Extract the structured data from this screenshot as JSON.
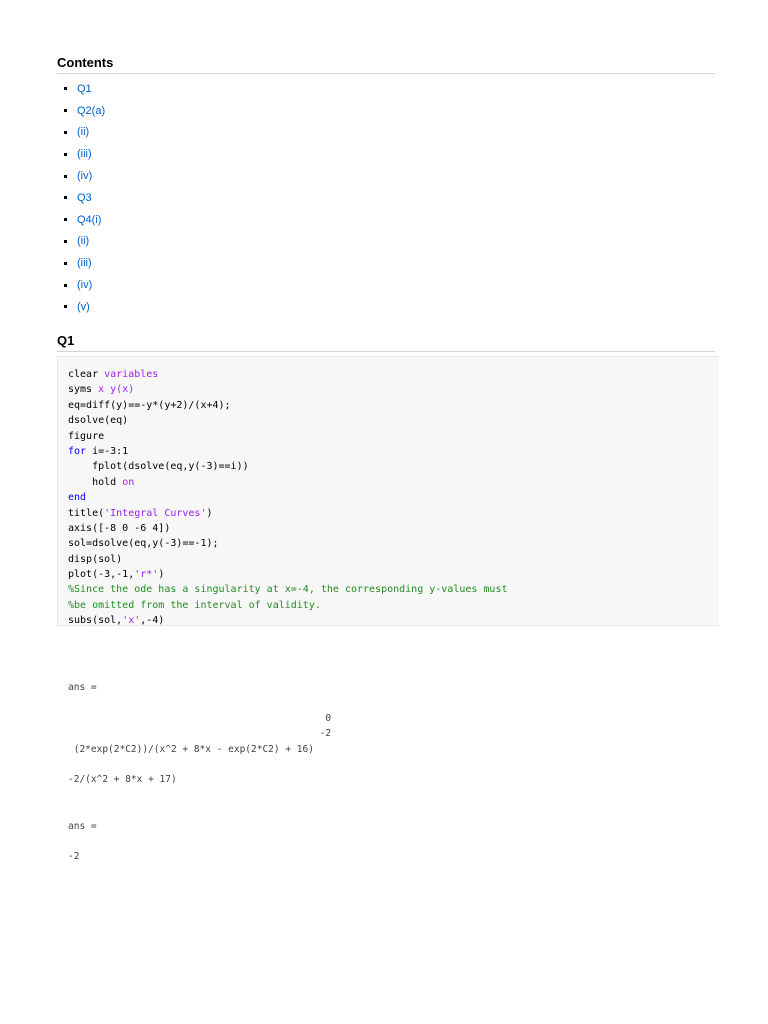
{
  "contents": {
    "heading": "Contents",
    "items": [
      "Q1",
      "Q2(a)",
      "(ii)",
      "(iii)",
      "(iv)",
      "Q3",
      "Q4(i)",
      "(ii)",
      "(iii)",
      "(iv)",
      "(v)"
    ]
  },
  "q1": {
    "heading": "Q1",
    "code": [
      [
        {
          "t": "clear ",
          "c": ""
        },
        {
          "t": "variables",
          "c": "str"
        }
      ],
      [
        {
          "t": "syms ",
          "c": ""
        },
        {
          "t": "x y(x)",
          "c": "str"
        }
      ],
      [
        {
          "t": "eq=diff(y)==-y*(y+2)/(x+4);",
          "c": ""
        }
      ],
      [
        {
          "t": "dsolve(eq)",
          "c": ""
        }
      ],
      [
        {
          "t": "figure",
          "c": ""
        }
      ],
      [
        {
          "t": "for",
          "c": "kw"
        },
        {
          "t": " i=-3:1",
          "c": ""
        }
      ],
      [
        {
          "t": "    fplot(dsolve(eq,y(-3)==i))",
          "c": ""
        }
      ],
      [
        {
          "t": "    hold ",
          "c": ""
        },
        {
          "t": "on",
          "c": "str"
        }
      ],
      [
        {
          "t": "end",
          "c": "kw"
        }
      ],
      [
        {
          "t": "title(",
          "c": ""
        },
        {
          "t": "'Integral Curves'",
          "c": "str"
        },
        {
          "t": ")",
          "c": ""
        }
      ],
      [
        {
          "t": "axis([-8 0 -6 4])",
          "c": ""
        }
      ],
      [
        {
          "t": "sol=dsolve(eq,y(-3)==-1);",
          "c": ""
        }
      ],
      [
        {
          "t": "disp(sol)",
          "c": ""
        }
      ],
      [
        {
          "t": "plot(-3,-1,",
          "c": ""
        },
        {
          "t": "'r*'",
          "c": "str"
        },
        {
          "t": ")",
          "c": ""
        }
      ],
      [
        {
          "t": "%Since the ode has a singularity at x=-4, the corresponding y-values must",
          "c": "cmt"
        }
      ],
      [
        {
          "t": "%be omitted from the interval of validity.",
          "c": "cmt"
        }
      ],
      [
        {
          "t": "subs(sol,",
          "c": ""
        },
        {
          "t": "'x'",
          "c": "str"
        },
        {
          "t": ",-4)",
          "c": ""
        }
      ]
    ],
    "output": [
      "ans = ",
      " ",
      "                                             0",
      "                                            -2",
      " (2*exp(2*C2))/(x^2 + 8*x - exp(2*C2) + 16)",
      " ",
      "-2/(x^2 + 8*x + 17)",
      " ",
      " ",
      "ans =",
      " ",
      "-2"
    ]
  }
}
